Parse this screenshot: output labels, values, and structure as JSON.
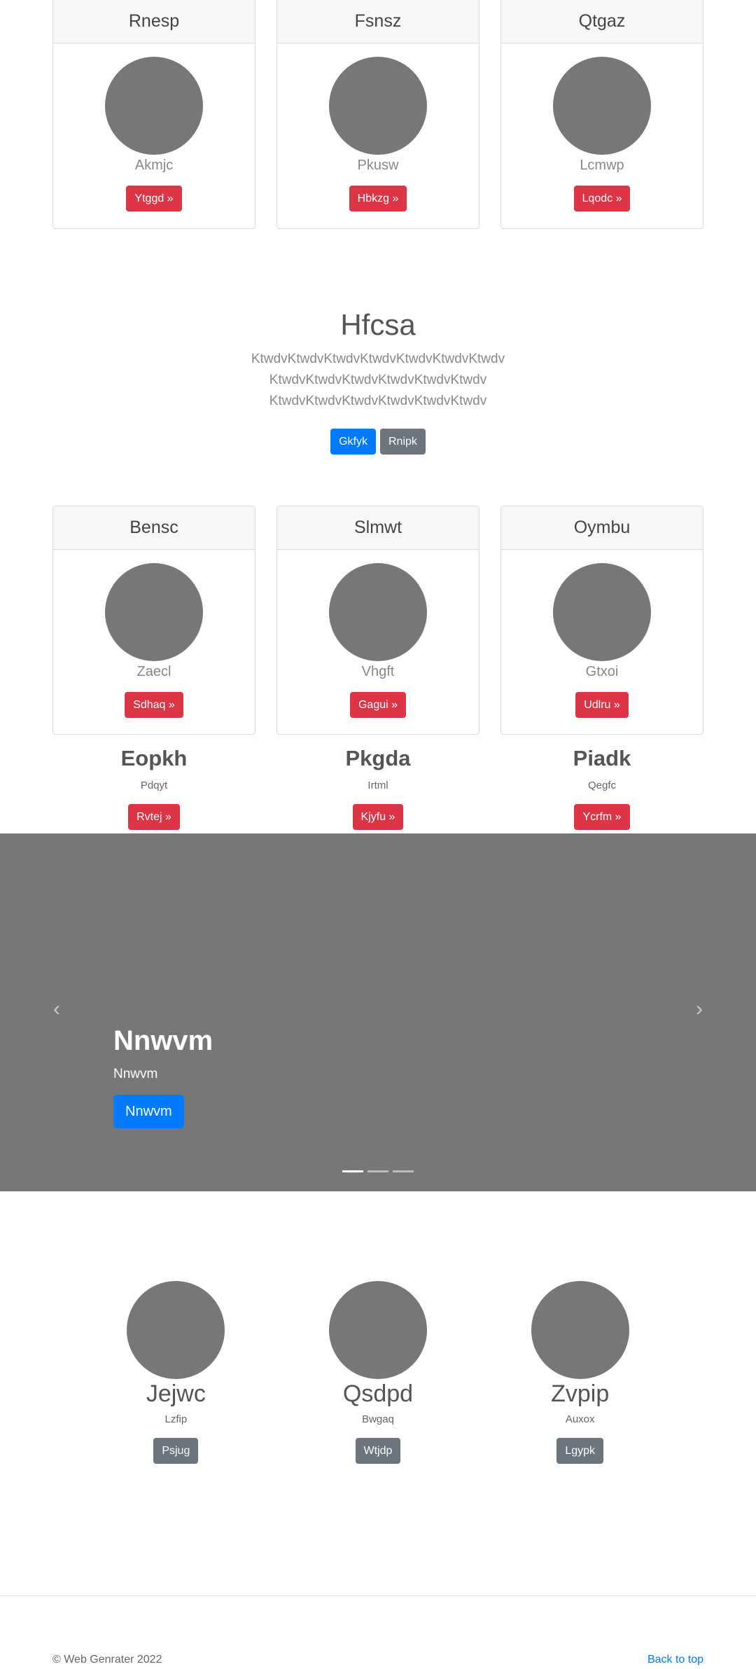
{
  "top_cards": [
    {
      "title": "Rnesp",
      "subtitle": "Akmjc",
      "button": "Ytggd »"
    },
    {
      "title": "Fsnsz",
      "subtitle": "Pkusw",
      "button": "Hbkzg »"
    },
    {
      "title": "Qtgaz",
      "subtitle": "Lcmwp",
      "button": "Lqodc »"
    }
  ],
  "hero": {
    "title": "Hfcsa",
    "text": "KtwdvKtwdvKtwdvKtwdvKtwdvKtwdvKtwdv KtwdvKtwdvKtwdvKtwdvKtwdvKtwdv KtwdvKtwdvKtwdvKtwdvKtwdvKtwdv",
    "primary_button": "Gkfyk",
    "secondary_button": "Rnipk"
  },
  "mid_cards": [
    {
      "title": "Bensc",
      "subtitle": "Zaecl",
      "button": "Sdhaq »"
    },
    {
      "title": "Slmwt",
      "subtitle": "Vhgft",
      "button": "Gagui »"
    },
    {
      "title": "Oymbu",
      "subtitle": "Gtxoi",
      "button": "Udlru »"
    }
  ],
  "features": [
    {
      "title": "Eopkh",
      "subtitle": "Pdqyt",
      "button": "Rvtej »"
    },
    {
      "title": "Pkgda",
      "subtitle": "Irtml",
      "button": "Kjyfu »"
    },
    {
      "title": "Piadk",
      "subtitle": "Qegfc",
      "button": "Ycrfm »"
    }
  ],
  "carousel": {
    "heading": "Nnwvm",
    "text": "Nnwvm",
    "button": "Nnwvm",
    "prev_icon": "‹",
    "next_icon": "›",
    "slide_count": 3,
    "active_slide": 1
  },
  "marketing": [
    {
      "title": "Jejwc",
      "subtitle": "Lzfip",
      "button": "Psjug"
    },
    {
      "title": "Qsdpd",
      "subtitle": "Bwgaq",
      "button": "Wtjdp"
    },
    {
      "title": "Zvpip",
      "subtitle": "Auxox",
      "button": "Lgypk"
    }
  ],
  "footer": {
    "copyright": "© Web Genrater 2022",
    "back_to_top": "Back to top"
  },
  "colors": {
    "primary": "#007bff",
    "danger": "#dc3545",
    "secondary": "#6c757d",
    "placeholder": "#777777"
  }
}
